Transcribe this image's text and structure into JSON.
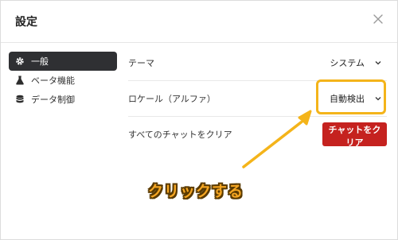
{
  "dialog": {
    "title": "設定",
    "close_icon": "close-icon"
  },
  "sidebar": {
    "items": [
      {
        "label": "一般",
        "icon": "gear-icon",
        "active": true
      },
      {
        "label": "ベータ機能",
        "icon": "flask-icon",
        "active": false
      },
      {
        "label": "データ制御",
        "icon": "database-icon",
        "active": false
      }
    ]
  },
  "settings": {
    "theme": {
      "label": "テーマ",
      "value": "システム"
    },
    "locale": {
      "label": "ロケール（アルファ）",
      "value": "自動検出"
    },
    "clear": {
      "label": "すべてのチャットをクリア",
      "button": "チャットをクリア"
    }
  },
  "annotation": {
    "text": "クリックする"
  },
  "colors": {
    "accent_highlight": "#f4b41a",
    "danger": "#c5221f",
    "sidebar_active": "#2f3033"
  }
}
